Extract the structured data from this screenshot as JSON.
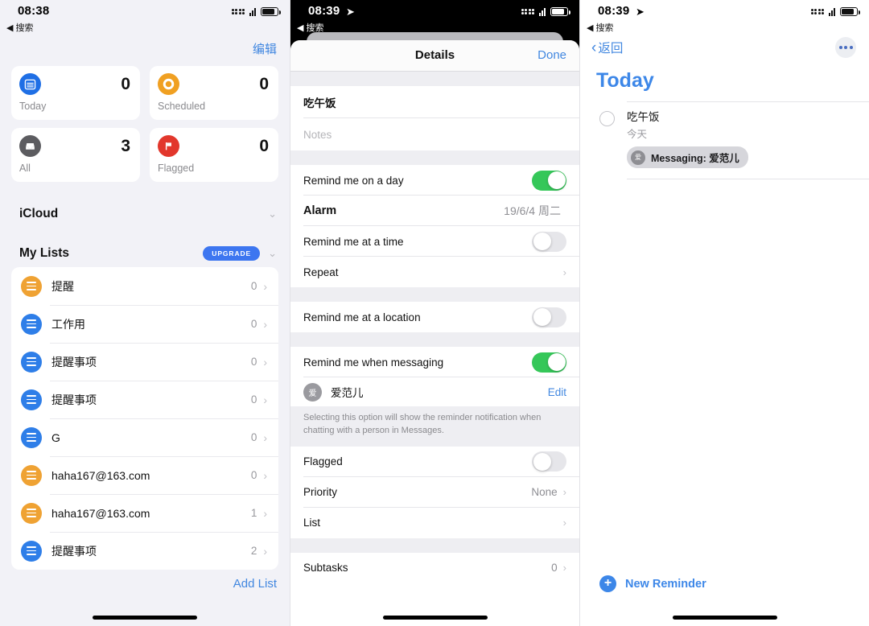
{
  "panel1": {
    "status": {
      "time": "08:38",
      "back_label": "◀ 搜索",
      "location_arrow": ""
    },
    "edit_label": "编辑",
    "smart_lists": [
      {
        "name": "Today",
        "count": "0",
        "icon": "calendar-icon",
        "color": "#1f6fe5"
      },
      {
        "name": "Scheduled",
        "count": "0",
        "icon": "clock-icon",
        "color": "#f0a022"
      },
      {
        "name": "All",
        "count": "3",
        "icon": "tray-icon",
        "color": "#5c5c60"
      },
      {
        "name": "Flagged",
        "count": "0",
        "icon": "flag-icon",
        "color": "#e2372c"
      }
    ],
    "icloud_section": {
      "title": "iCloud",
      "chevron": "⌄"
    },
    "mylists_section": {
      "title": "My Lists",
      "upgrade_label": "UPGRADE",
      "chevron": "⌄"
    },
    "lists": [
      {
        "name": "提醒",
        "count": "0",
        "color": "#efa233"
      },
      {
        "name": "工作用",
        "count": "0",
        "color": "#2e7ee8"
      },
      {
        "name": "提醒事项",
        "count": "0",
        "color": "#2e7ee8"
      },
      {
        "name": "提醒事项",
        "count": "0",
        "color": "#2e7ee8"
      },
      {
        "name": "G",
        "count": "0",
        "color": "#2e7ee8"
      },
      {
        "name": "haha167@163.com",
        "count": "0",
        "color": "#efa233"
      },
      {
        "name": "haha167@163.com",
        "count": "1",
        "color": "#efa233"
      },
      {
        "name": "提醒事项",
        "count": "2",
        "color": "#2e7ee8"
      }
    ],
    "add_list_label": "Add List"
  },
  "panel2": {
    "status": {
      "time": "08:39",
      "back_label": "◀ 搜索",
      "location_arrow": "➤"
    },
    "nav": {
      "title": "Details",
      "done_label": "Done"
    },
    "reminder_title": "吃午饭",
    "notes_placeholder": "Notes",
    "rows": {
      "remind_day_label": "Remind me on a day",
      "remind_day_state": "on",
      "alarm_label": "Alarm",
      "alarm_value": "19/6/4 周二",
      "remind_time_label": "Remind me at a time",
      "remind_time_state": "off",
      "repeat_label": "Repeat",
      "remind_location_label": "Remind me at a location",
      "remind_location_state": "off",
      "remind_messaging_label": "Remind me when messaging",
      "remind_messaging_state": "on",
      "contact_initial": "爱",
      "contact_name": "爱范儿",
      "contact_edit_label": "Edit",
      "messaging_footnote": "Selecting this option will show the reminder notification when chatting with a person in Messages.",
      "flagged_label": "Flagged",
      "flagged_state": "off",
      "priority_label": "Priority",
      "priority_value": "None",
      "list_label": "List",
      "subtasks_label": "Subtasks",
      "subtasks_value": "0"
    }
  },
  "panel3": {
    "status": {
      "time": "08:39",
      "back_label": "◀ 搜索",
      "location_arrow": "➤"
    },
    "back_label": "返回",
    "title": "Today",
    "title_color": "#3d87e8",
    "reminder": {
      "title": "吃午饭",
      "subtitle": "今天",
      "tag_initial": "爱",
      "tag_label": "Messaging: 爱范儿"
    },
    "new_reminder_label": "New Reminder"
  }
}
